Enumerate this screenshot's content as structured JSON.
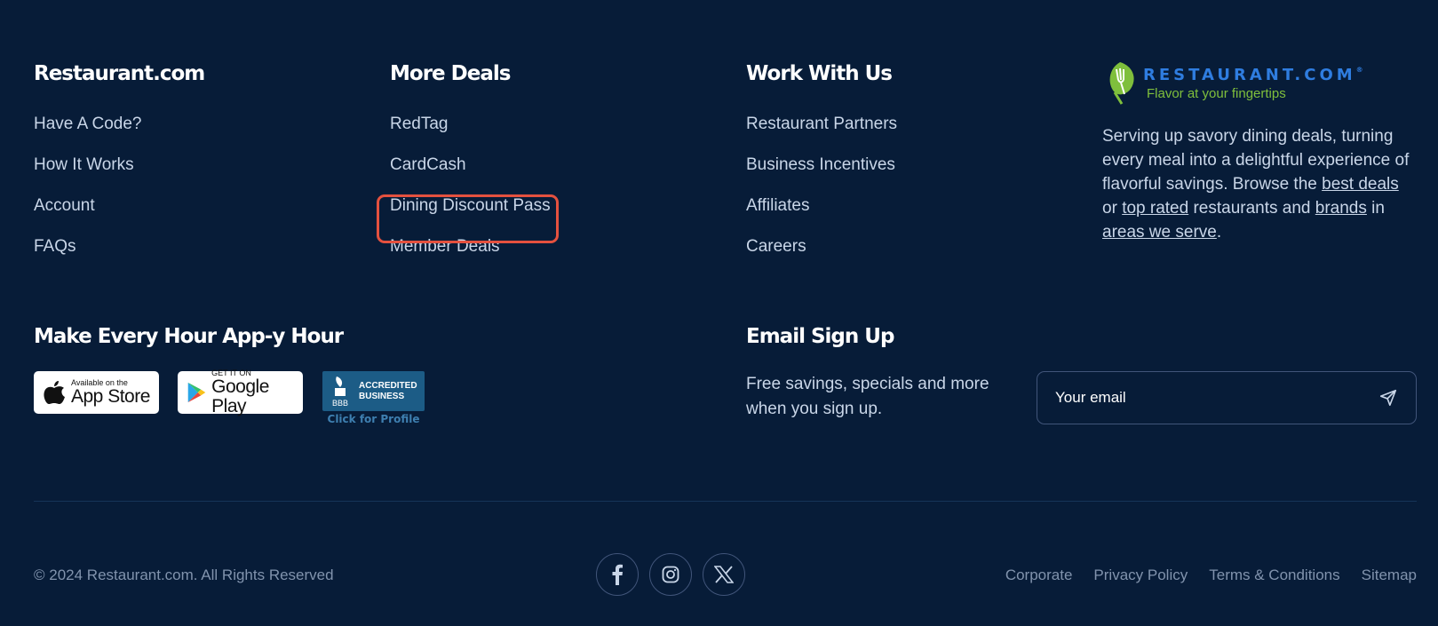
{
  "columns": [
    {
      "title": "Restaurant.com",
      "links": [
        "Have A Code?",
        "How It Works",
        "Account",
        "FAQs"
      ]
    },
    {
      "title": "More Deals",
      "links": [
        "RedTag",
        "CardCash",
        "Dining Discount Pass",
        "Member Deals"
      ]
    },
    {
      "title": "Work With Us",
      "links": [
        "Restaurant Partners",
        "Business Incentives",
        "Affiliates",
        "Careers"
      ]
    }
  ],
  "brand": {
    "name": "RESTAURANT.COM",
    "trademark": "®",
    "tagline": "Flavor at your fingertips",
    "desc_1": "Serving up savory dining deals, turning every meal into a delightful experience of flavorful savings. Browse the ",
    "link_best_deals": "best deals",
    "desc_2": " or ",
    "link_top_rated": "top rated",
    "desc_3": " restaurants and ",
    "link_brands": "brands",
    "desc_4": " in ",
    "link_areas": "areas we serve",
    "desc_5": "."
  },
  "app": {
    "title": "Make Every Hour App-y Hour",
    "appstore_small": "Available on the",
    "appstore_big": "App Store",
    "googleplay_small": "GET IT ON",
    "googleplay_big": "Google Play",
    "bbb_letters": "BBB",
    "bbb_line1": "ACCREDITED",
    "bbb_line2": "BUSINESS",
    "bbb_click": "Click for Profile"
  },
  "email": {
    "title": "Email Sign Up",
    "text": "Free savings, specials and more when you sign up.",
    "placeholder": "Your email"
  },
  "footer": {
    "copyright": "© 2024 Restaurant.com. All Rights Reserved",
    "social": [
      "facebook-icon",
      "instagram-icon",
      "x-icon"
    ],
    "links": [
      "Corporate",
      "Privacy Policy",
      "Terms & Conditions",
      "Sitemap"
    ]
  },
  "colors": {
    "background": "#071c38",
    "highlight": "#e4513f",
    "brand_blue": "#2f7de0",
    "brand_green": "#7fbf3c"
  }
}
